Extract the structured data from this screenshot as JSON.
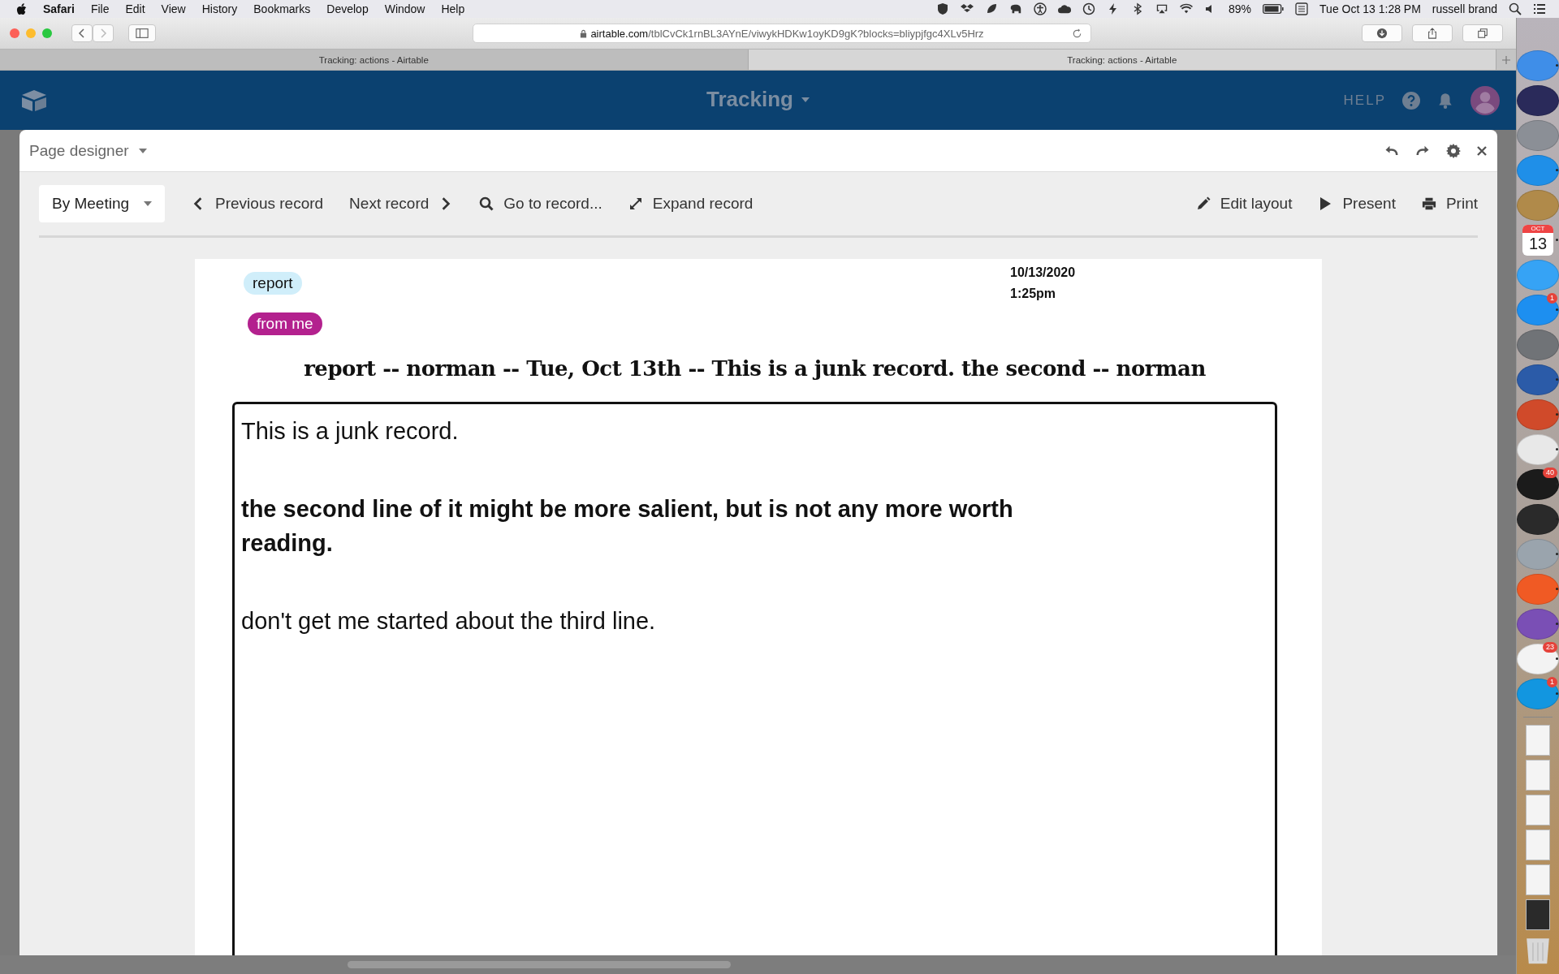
{
  "menu_bar": {
    "app": "Safari",
    "items": [
      "File",
      "Edit",
      "View",
      "History",
      "Bookmarks",
      "Develop",
      "Window",
      "Help"
    ],
    "battery": "89%",
    "clock": "Tue Oct 13  1:28 PM",
    "user": "russell brand"
  },
  "browser": {
    "url_host": "airtable.com",
    "url_path": "/tblCvCk1rnBL3AYnE/viwykHDKw1oyKD9gK?blocks=bliypjfgc4XLv5Hrz",
    "tabs": [
      {
        "title": "Tracking: actions - Airtable",
        "selected": false
      },
      {
        "title": "Tracking: actions - Airtable",
        "selected": true
      }
    ]
  },
  "app_header": {
    "base_name": "Tracking",
    "help": "HELP"
  },
  "designer": {
    "title": "Page designer",
    "toolbar_left": [
      {
        "kind": "dropdown",
        "label": "By Meeting"
      },
      {
        "kind": "prev",
        "label": "Previous record"
      },
      {
        "kind": "next",
        "label": "Next record"
      },
      {
        "kind": "search",
        "label": "Go to record..."
      },
      {
        "kind": "expand",
        "label": "Expand record"
      }
    ],
    "toolbar_right": [
      {
        "kind": "edit",
        "label": "Edit layout"
      },
      {
        "kind": "play",
        "label": "Present"
      },
      {
        "kind": "print",
        "label": "Print"
      }
    ],
    "record": {
      "tags": [
        {
          "label": "report",
          "color": "#d0eefa"
        },
        {
          "label": "from me",
          "color": "#b3218e"
        }
      ],
      "date": "10/13/2020",
      "time": "1:25pm",
      "title": "report -- norman -- Tue, Oct 13th -- This is a junk record.  the second -- norman",
      "paragraphs": [
        {
          "text": "This is a junk record.",
          "bold": false
        },
        {
          "text": "the second line of it might be more salient, but is not any more worth reading.",
          "bold": true
        },
        {
          "text": "don't get me started about the third line.",
          "bold": false
        }
      ]
    }
  },
  "dock": [
    {
      "kind": "app",
      "color": "#3f8ee8",
      "running": true
    },
    {
      "kind": "app",
      "color": "#2a2a5a",
      "running": false
    },
    {
      "kind": "app",
      "color": "#8b8f96",
      "running": false
    },
    {
      "kind": "app",
      "color": "#1f8fe8",
      "running": true
    },
    {
      "kind": "app",
      "color": "#b08a4a",
      "running": false
    },
    {
      "kind": "calendar",
      "color": "#ffffff",
      "running": true,
      "month": "OCT",
      "day": "13"
    },
    {
      "kind": "app",
      "color": "#36a3f5",
      "running": false
    },
    {
      "kind": "app",
      "color": "#1d8ff0",
      "running": true,
      "badge": "1"
    },
    {
      "kind": "app",
      "color": "#707377",
      "running": false
    },
    {
      "kind": "app",
      "color": "#2b5ba8",
      "running": true
    },
    {
      "kind": "app",
      "color": "#d04a2a",
      "running": true
    },
    {
      "kind": "app",
      "color": "#e8e8e8",
      "running": true
    },
    {
      "kind": "app",
      "color": "#1b1b1b",
      "running": true,
      "badge": "40"
    },
    {
      "kind": "app",
      "color": "#2a2a2a",
      "running": true
    },
    {
      "kind": "app",
      "color": "#9aa4ad",
      "running": true
    },
    {
      "kind": "app",
      "color": "#f05a24",
      "running": true
    },
    {
      "kind": "app",
      "color": "#7a4fb5",
      "running": true
    },
    {
      "kind": "app",
      "color": "#f3f3f3",
      "running": true,
      "badge": "23"
    },
    {
      "kind": "app",
      "color": "#1296e0",
      "running": true,
      "badge": "1"
    },
    {
      "kind": "separator"
    },
    {
      "kind": "file",
      "color": "#f4f4f4"
    },
    {
      "kind": "file",
      "color": "#f4f4f4"
    },
    {
      "kind": "file",
      "color": "#f4f4f4"
    },
    {
      "kind": "file",
      "color": "#f4f4f4"
    },
    {
      "kind": "file",
      "color": "#f4f4f4"
    },
    {
      "kind": "file",
      "color": "#2a2a2a"
    },
    {
      "kind": "trash",
      "color": "#d8d8d8"
    }
  ]
}
